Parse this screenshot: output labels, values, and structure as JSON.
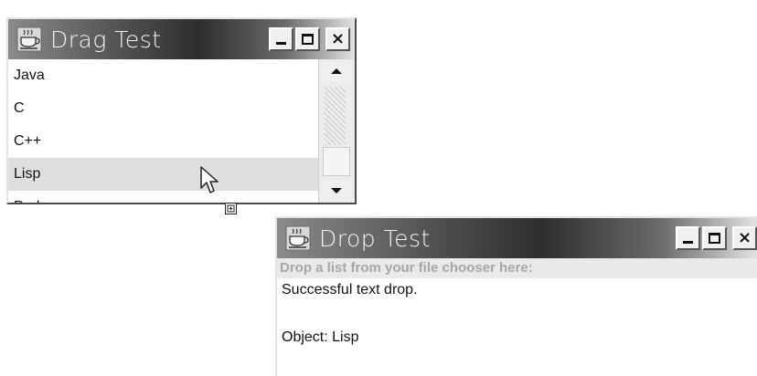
{
  "drag_window": {
    "title": "Drag Test",
    "minimize_glyph": "minimize-icon",
    "maximize_glyph": "maximize-icon",
    "close_label": "×",
    "list_items": [
      "Java",
      "C",
      "C++",
      "Lisp",
      "Perl"
    ],
    "selected_item": "Lisp"
  },
  "drop_window": {
    "title": "Drop Test",
    "close_label": "×",
    "instruction": "Drop a list from your file chooser here:",
    "status": "Successful text drop.",
    "object_line": "Object: Lisp"
  },
  "icons": {
    "app_icon": "java-cup-icon",
    "pointer": "arrow-cursor-icon",
    "drag_indicator": "drag-copy-icon"
  }
}
